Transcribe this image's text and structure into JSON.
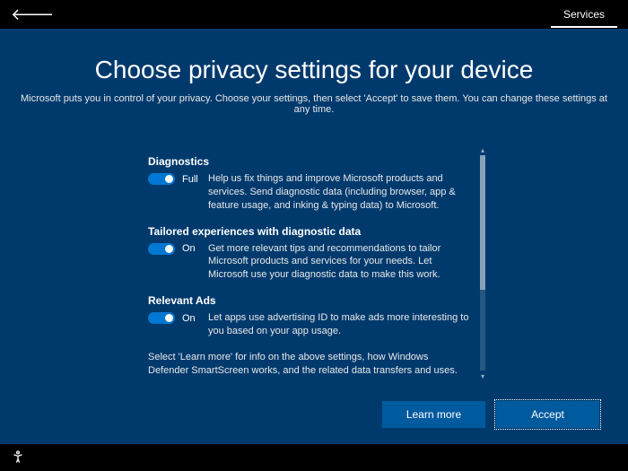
{
  "topbar": {
    "tab_label": "Services"
  },
  "header": {
    "title": "Choose privacy settings for your device",
    "subtitle": "Microsoft puts you in control of your privacy. Choose your settings, then select 'Accept' to save them. You can change these settings at any time."
  },
  "settings": {
    "diagnostics": {
      "title": "Diagnostics",
      "state": "Full",
      "description": "Help us fix things and improve Microsoft products and services. Send diagnostic data (including browser, app & feature usage, and inking & typing data) to Microsoft."
    },
    "tailored": {
      "title": "Tailored experiences with diagnostic data",
      "state": "On",
      "description": "Get more relevant tips and recommendations to tailor Microsoft products and services for your needs. Let Microsoft use your diagnostic data to make this work."
    },
    "ads": {
      "title": "Relevant Ads",
      "state": "On",
      "description": "Let apps use advertising ID to make ads more interesting to you based on your app usage."
    },
    "footer_note": "Select 'Learn more' for info on the above settings, how Windows Defender SmartScreen works, and the related data transfers and uses."
  },
  "buttons": {
    "learn_more": "Learn more",
    "accept": "Accept"
  }
}
